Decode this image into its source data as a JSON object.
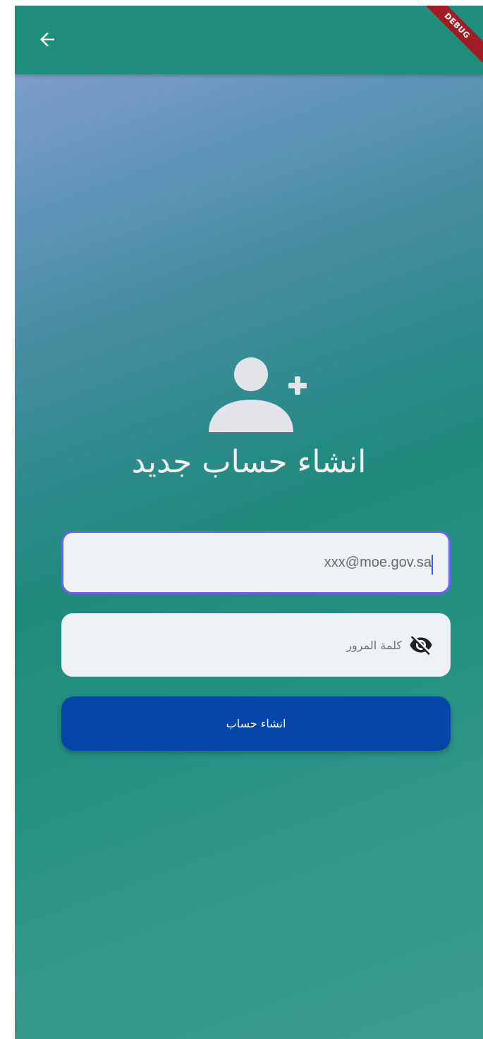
{
  "appbar": {
    "back_icon": "arrow-back-icon",
    "debug_banner": "DEBUG"
  },
  "header": {
    "icon": "person-add-icon",
    "title": "انشاء حساب جديد"
  },
  "form": {
    "email": {
      "value": "xxx@moe.gov.sa"
    },
    "password": {
      "placeholder": "كلمة المرور",
      "toggle_icon": "eye-off-icon"
    },
    "submit_label": "انشاء حساب"
  },
  "colors": {
    "appbar": "#1f8f7c",
    "button": "#0546a8",
    "focus_border": "#6d5ff0",
    "field_bg": "#eef1f6"
  }
}
